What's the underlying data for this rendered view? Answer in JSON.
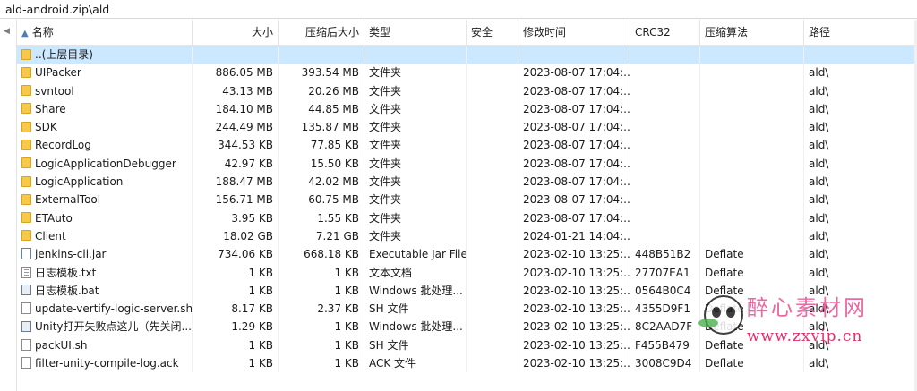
{
  "path": "ald-android.zip\\ald",
  "columns": {
    "name": "名称",
    "size": "大小",
    "compressed": "压缩后大小",
    "type": "类型",
    "security": "安全",
    "modified": "修改时间",
    "crc": "CRC32",
    "algorithm": "压缩算法",
    "path": "路径"
  },
  "rows": [
    {
      "name": "..(上层目录)",
      "icon": "folder-icon",
      "size": "",
      "compressed": "",
      "type": "",
      "modified": "",
      "crc": "",
      "algorithm": "",
      "path": ""
    },
    {
      "name": "UIPacker",
      "icon": "folder-icon",
      "size": "886.05 MB",
      "compressed": "393.54 MB",
      "type": "文件夹",
      "modified": "2023-08-07 17:04:...",
      "crc": "",
      "algorithm": "",
      "path": "ald\\"
    },
    {
      "name": "svntool",
      "icon": "folder-icon",
      "size": "43.13 MB",
      "compressed": "20.26 MB",
      "type": "文件夹",
      "modified": "2023-08-07 17:04:...",
      "crc": "",
      "algorithm": "",
      "path": "ald\\"
    },
    {
      "name": "Share",
      "icon": "folder-icon",
      "size": "184.10 MB",
      "compressed": "44.85 MB",
      "type": "文件夹",
      "modified": "2023-08-07 17:04:...",
      "crc": "",
      "algorithm": "",
      "path": "ald\\"
    },
    {
      "name": "SDK",
      "icon": "folder-icon",
      "size": "244.49 MB",
      "compressed": "135.87 MB",
      "type": "文件夹",
      "modified": "2023-08-07 17:04:...",
      "crc": "",
      "algorithm": "",
      "path": "ald\\"
    },
    {
      "name": "RecordLog",
      "icon": "folder-icon",
      "size": "344.53 KB",
      "compressed": "77.85 KB",
      "type": "文件夹",
      "modified": "2023-08-07 17:04:...",
      "crc": "",
      "algorithm": "",
      "path": "ald\\"
    },
    {
      "name": "LogicApplicationDebugger",
      "icon": "folder-icon",
      "size": "42.97 KB",
      "compressed": "15.50 KB",
      "type": "文件夹",
      "modified": "2023-08-07 17:04:...",
      "crc": "",
      "algorithm": "",
      "path": "ald\\"
    },
    {
      "name": "LogicApplication",
      "icon": "folder-icon",
      "size": "188.47 MB",
      "compressed": "42.02 MB",
      "type": "文件夹",
      "modified": "2023-08-07 17:04:...",
      "crc": "",
      "algorithm": "",
      "path": "ald\\"
    },
    {
      "name": "ExternalTool",
      "icon": "folder-icon",
      "size": "156.71 MB",
      "compressed": "60.75 MB",
      "type": "文件夹",
      "modified": "2023-08-07 17:04:...",
      "crc": "",
      "algorithm": "",
      "path": "ald\\"
    },
    {
      "name": "ETAuto",
      "icon": "folder-icon",
      "size": "3.95 KB",
      "compressed": "1.55 KB",
      "type": "文件夹",
      "modified": "2023-08-07 17:04:...",
      "crc": "",
      "algorithm": "",
      "path": "ald\\"
    },
    {
      "name": "Client",
      "icon": "folder-icon",
      "size": "18.02 GB",
      "compressed": "7.21 GB",
      "type": "文件夹",
      "modified": "2024-01-21 14:04:...",
      "crc": "",
      "algorithm": "",
      "path": "ald\\"
    },
    {
      "name": "jenkins-cli.jar",
      "icon": "jar-icon",
      "size": "734.06 KB",
      "compressed": "668.18 KB",
      "type": "Executable Jar File",
      "modified": "2023-02-10 13:25:...",
      "crc": "448B51B2",
      "algorithm": "Deflate",
      "path": "ald\\"
    },
    {
      "name": "日志模板.txt",
      "icon": "txt-icon",
      "size": "1 KB",
      "compressed": "1 KB",
      "type": "文本文档",
      "modified": "2023-02-10 13:25:...",
      "crc": "27707EA1",
      "algorithm": "Deflate",
      "path": "ald\\"
    },
    {
      "name": "日志模板.bat",
      "icon": "bat-icon",
      "size": "1 KB",
      "compressed": "1 KB",
      "type": "Windows 批处理...",
      "modified": "2023-02-10 13:25:...",
      "crc": "0564B0C4",
      "algorithm": "Deflate",
      "path": "ald\\"
    },
    {
      "name": "update-vertify-logic-server.sh",
      "icon": "file-icon",
      "size": "8.17 KB",
      "compressed": "2.37 KB",
      "type": "SH 文件",
      "modified": "2023-02-10 13:25:...",
      "crc": "4355D9F1",
      "algorithm": "Deflate",
      "path": "ald\\"
    },
    {
      "name": "Unity打开失败点这儿（先关闭...",
      "icon": "bat-icon",
      "size": "1.29 KB",
      "compressed": "1 KB",
      "type": "Windows 批处理...",
      "modified": "2023-02-10 13:25:...",
      "crc": "8C2AAD7F",
      "algorithm": "Deflate",
      "path": "ald\\"
    },
    {
      "name": "packUI.sh",
      "icon": "file-icon",
      "size": "1 KB",
      "compressed": "1 KB",
      "type": "SH 文件",
      "modified": "2023-02-10 13:25:...",
      "crc": "F455B479",
      "algorithm": "Deflate",
      "path": "ald\\"
    },
    {
      "name": "filter-unity-compile-log.ack",
      "icon": "file-icon",
      "size": "1 KB",
      "compressed": "1 KB",
      "type": "ACK 文件",
      "modified": "2023-02-10 13:25:...",
      "crc": "3008C9D4",
      "algorithm": "Deflate",
      "path": "ald\\"
    }
  ],
  "watermark": {
    "title": "醉心素材网",
    "url": "www.zxvip.cn"
  }
}
